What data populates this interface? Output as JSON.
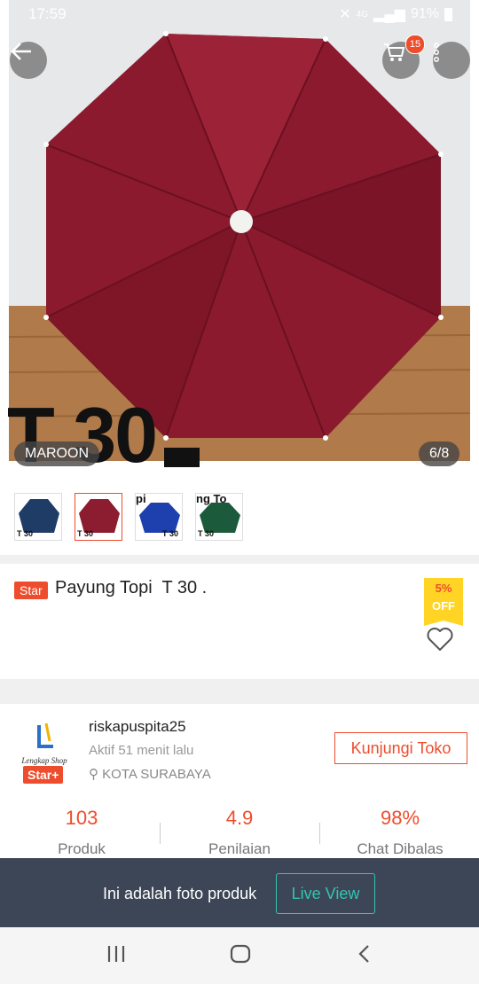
{
  "status": {
    "time": "17:59",
    "network": "4G",
    "battery": "91%"
  },
  "hero": {
    "color_label": "MAROON",
    "page_indicator": "6/8",
    "overlay_text": "T 30",
    "cart_count": "15"
  },
  "thumbnails": [
    {
      "caption": "T 30",
      "color": "#1f3c66"
    },
    {
      "caption": "T 30",
      "color": "#8c1c30",
      "active": true
    },
    {
      "caption": "T 30",
      "color": "#1e3fae",
      "banner": "pi"
    },
    {
      "caption": "T 30",
      "color": "#1b5a3a",
      "banner": "ng To"
    }
  ],
  "product": {
    "star_tag": "Star",
    "title": "Payung Topi  T 30 .",
    "discount_percent": "5%",
    "discount_label": "OFF"
  },
  "shop": {
    "logo_text": "Lengkap Shop",
    "badge": "Star+",
    "name": "riskapuspita25",
    "active": "Aktif 51 menit lalu",
    "location": "KOTA SURABAYA",
    "visit_button": "Kunjungi Toko",
    "stats": [
      {
        "value": "103",
        "label": "Produk"
      },
      {
        "value": "4.9",
        "label": "Penilaian"
      },
      {
        "value": "98%",
        "label": "Chat Dibalas"
      }
    ]
  },
  "live_banner": {
    "text": "Ini adalah foto produk",
    "button": "Live View"
  },
  "colors": {
    "accent": "#ee4d2d",
    "teal": "#34c4b0",
    "umbrella": "#8b1a2e"
  }
}
